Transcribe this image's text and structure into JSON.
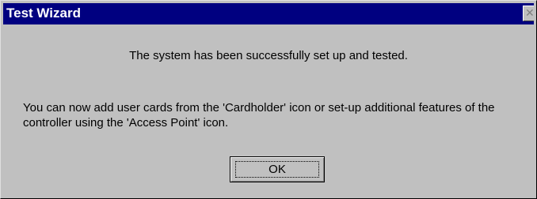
{
  "window": {
    "title": "Test Wizard",
    "close_icon": "close-icon",
    "close_glyph": "✕"
  },
  "message": {
    "primary": "The system has been successfully set up and tested.",
    "secondary": "You can now add user cards from the 'Cardholder' icon or set-up additional features of the controller using the 'Access Point' icon."
  },
  "buttons": {
    "ok_label": "OK"
  },
  "colors": {
    "titlebar": "#000080",
    "dialog_face": "#c0c0c0",
    "title_text": "#ffffff"
  }
}
